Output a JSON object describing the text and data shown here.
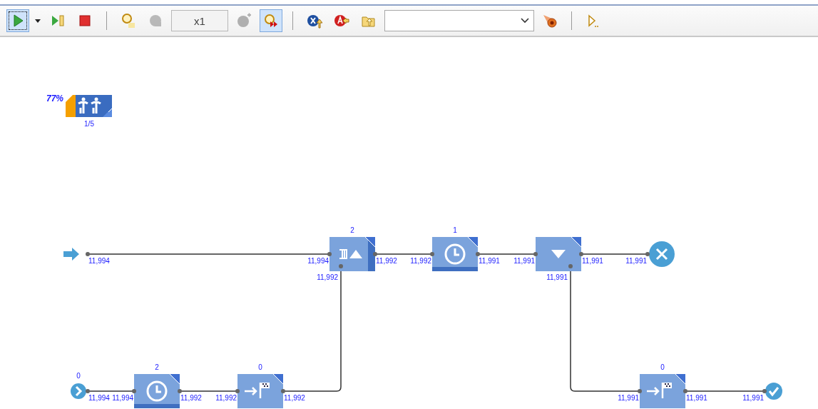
{
  "toolbar": {
    "groups": [
      [
        {
          "kind": "run",
          "selected": true,
          "disabled": false
        },
        {
          "kind": "caret",
          "selected": false,
          "disabled": false
        },
        {
          "kind": "step",
          "selected": false,
          "disabled": false
        },
        {
          "kind": "stop",
          "selected": false,
          "disabled": false
        }
      ],
      [
        {
          "kind": "time-mode",
          "selected": false,
          "disabled": false
        },
        {
          "kind": "slow",
          "selected": false,
          "disabled": true
        },
        {
          "kind": "speed-field",
          "value": "x1"
        },
        {
          "kind": "fast",
          "selected": false,
          "disabled": true
        },
        {
          "kind": "virtual-time",
          "selected": true,
          "disabled": false
        }
      ],
      [
        {
          "kind": "x-up",
          "selected": false,
          "disabled": false
        },
        {
          "kind": "a-left",
          "selected": false,
          "disabled": false
        },
        {
          "kind": "folder-up",
          "selected": false,
          "disabled": false
        },
        {
          "kind": "combo"
        },
        {
          "kind": "comet",
          "selected": false,
          "disabled": false
        }
      ],
      [
        {
          "kind": "play-more",
          "selected": false,
          "disabled": false
        }
      ]
    ]
  },
  "resource_pool": {
    "utilization": "77%",
    "count": "1/5"
  },
  "nodes": [
    {
      "kind": "source-arrow",
      "out": "11,994"
    },
    {
      "kind": "hold",
      "count": "2",
      "in": "11,994",
      "side": "11,992",
      "out": "11,992"
    },
    {
      "kind": "delay",
      "count": "1",
      "in": "11,992",
      "out": "11,991"
    },
    {
      "kind": "select-output",
      "in": "11,991",
      "side": "11,991",
      "out": "11,991"
    },
    {
      "kind": "sink-cross",
      "in": "11,991"
    },
    {
      "kind": "source-circle",
      "count": "0",
      "out": "11,994"
    },
    {
      "kind": "delay",
      "count": "2",
      "in": "11,994",
      "out": "11,992"
    },
    {
      "kind": "move-to",
      "count": "0",
      "in": "11,992",
      "out": "11,992"
    },
    {
      "kind": "move-to",
      "count": "0",
      "in": "11,991",
      "out": "11,991"
    },
    {
      "kind": "sink-check",
      "in": "11,991"
    }
  ]
}
